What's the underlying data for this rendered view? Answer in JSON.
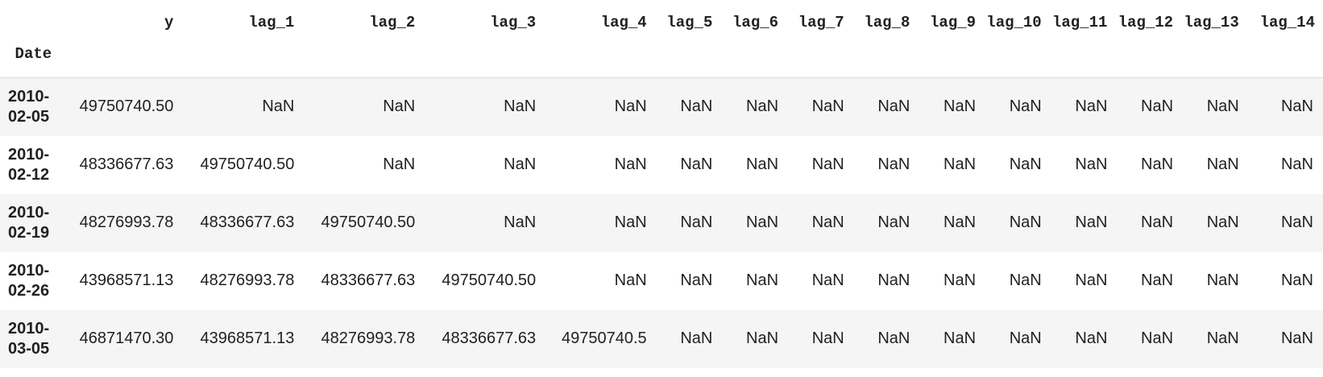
{
  "table": {
    "index_name": "Date",
    "columns": [
      "y",
      "lag_1",
      "lag_2",
      "lag_3",
      "lag_4",
      "lag_5",
      "lag_6",
      "lag_7",
      "lag_8",
      "lag_9",
      "lag_10",
      "lag_11",
      "lag_12",
      "lag_13",
      "lag_14"
    ],
    "rows": [
      {
        "index": [
          "2010-",
          "02-05"
        ],
        "cells": [
          "49750740.50",
          "NaN",
          "NaN",
          "NaN",
          "NaN",
          "NaN",
          "NaN",
          "NaN",
          "NaN",
          "NaN",
          "NaN",
          "NaN",
          "NaN",
          "NaN",
          "NaN"
        ]
      },
      {
        "index": [
          "2010-",
          "02-12"
        ],
        "cells": [
          "48336677.63",
          "49750740.50",
          "NaN",
          "NaN",
          "NaN",
          "NaN",
          "NaN",
          "NaN",
          "NaN",
          "NaN",
          "NaN",
          "NaN",
          "NaN",
          "NaN",
          "NaN"
        ]
      },
      {
        "index": [
          "2010-",
          "02-19"
        ],
        "cells": [
          "48276993.78",
          "48336677.63",
          "49750740.50",
          "NaN",
          "NaN",
          "NaN",
          "NaN",
          "NaN",
          "NaN",
          "NaN",
          "NaN",
          "NaN",
          "NaN",
          "NaN",
          "NaN"
        ]
      },
      {
        "index": [
          "2010-",
          "02-26"
        ],
        "cells": [
          "43968571.13",
          "48276993.78",
          "48336677.63",
          "49750740.50",
          "NaN",
          "NaN",
          "NaN",
          "NaN",
          "NaN",
          "NaN",
          "NaN",
          "NaN",
          "NaN",
          "NaN",
          "NaN"
        ]
      },
      {
        "index": [
          "2010-",
          "03-05"
        ],
        "cells": [
          "46871470.30",
          "43968571.13",
          "48276993.78",
          "48336677.63",
          "49750740.5",
          "NaN",
          "NaN",
          "NaN",
          "NaN",
          "NaN",
          "NaN",
          "NaN",
          "NaN",
          "NaN",
          "NaN"
        ]
      }
    ]
  }
}
